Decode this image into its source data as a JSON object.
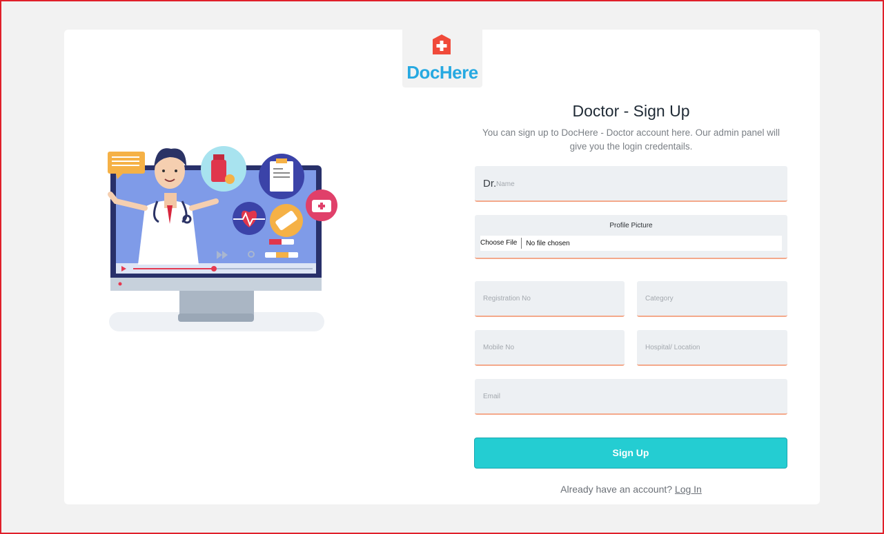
{
  "brand": {
    "name": "DocHere",
    "accent": "#27a9e1",
    "logo_color": "#f04a3a"
  },
  "form": {
    "title": "Doctor - Sign Up",
    "subtitle": "You can sign up to DocHere - Doctor account here. Our admin panel will give you the login credentails.",
    "name_prefix": "Dr.",
    "name_placeholder": "Name",
    "profile_picture_label": "Profile Picture",
    "choose_file_label": "Choose File",
    "file_status": "No file chosen",
    "registration_placeholder": "Registration No",
    "category_placeholder": "Category",
    "mobile_placeholder": "Mobile No",
    "hospital_placeholder": "Hospital/ Location",
    "email_placeholder": "Email",
    "submit_label": "Sign Up",
    "login_prompt": "Already have an account?",
    "login_link": "Log In"
  },
  "colors": {
    "button": "#24cdd2",
    "field_bg": "#edf0f3",
    "field_underline": "#f4a88a",
    "frame": "#e0202a"
  },
  "icons": [
    "hospital-logo-icon",
    "doctor-telehealth-illustration"
  ]
}
